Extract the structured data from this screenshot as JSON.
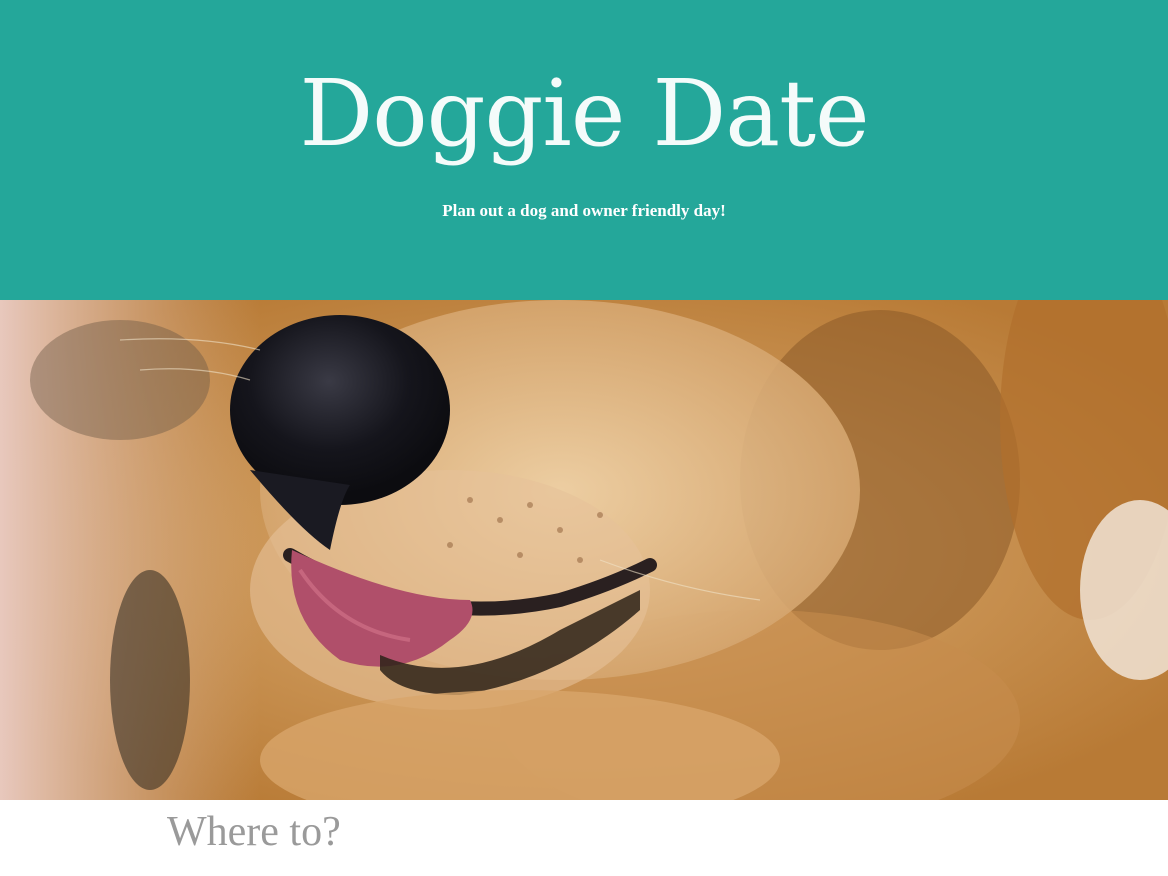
{
  "header": {
    "title": "Doggie Date",
    "tagline": "Plan out a dog and owner friendly day!",
    "background_color": "#24a79a"
  },
  "hero": {
    "image_alt": "golden-retriever-closeup-photo"
  },
  "main": {
    "section_heading": "Where to?"
  }
}
